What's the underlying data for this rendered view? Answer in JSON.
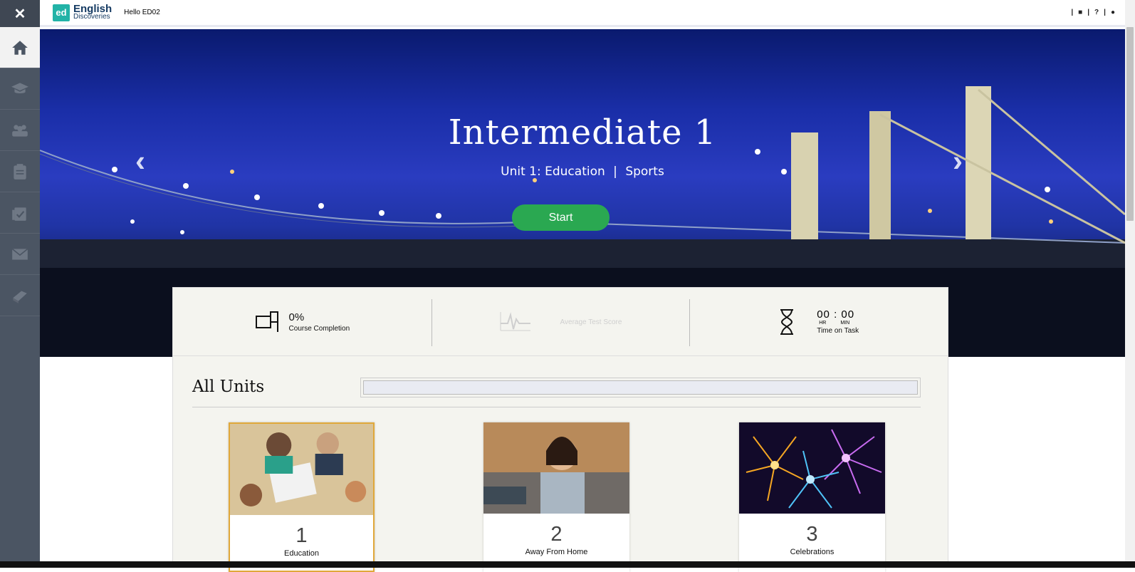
{
  "topbar": {
    "logo_badge": "ed",
    "logo_line1": "English",
    "logo_line2": "Discoveries",
    "greeting": "Hello ED02",
    "help_label": "?"
  },
  "sidebar": {
    "close_label": "✕",
    "items": [
      "home-icon",
      "graduation-cap-icon",
      "users-icon",
      "clipboard-icon",
      "assignments-icon",
      "mail-icon",
      "book-icon"
    ]
  },
  "hero": {
    "title": "Intermediate 1",
    "unit_line": "Unit 1: Education",
    "topic": "Sports",
    "separator": "|",
    "start_label": "Start",
    "prev_arrow": "‹",
    "next_arrow": "›"
  },
  "stats": {
    "completion_value": "0%",
    "completion_label": "Course Completion",
    "avg_score_label": "Average Test Score",
    "time_hours": "00",
    "time_sep": ":",
    "time_minutes": "00",
    "time_hr_label": "HR",
    "time_min_label": "MIN",
    "time_label": "Time on Task"
  },
  "units": {
    "title": "All Units",
    "search_value": "",
    "cards": [
      {
        "number": "1",
        "name": "Education"
      },
      {
        "number": "2",
        "name": "Away From Home"
      },
      {
        "number": "3",
        "name": "Celebrations"
      }
    ]
  },
  "colors": {
    "sidebar": "#4b5563",
    "start_button": "#2aa851",
    "logo": "#22b3a7",
    "selected_card_border": "#e0a83a"
  }
}
